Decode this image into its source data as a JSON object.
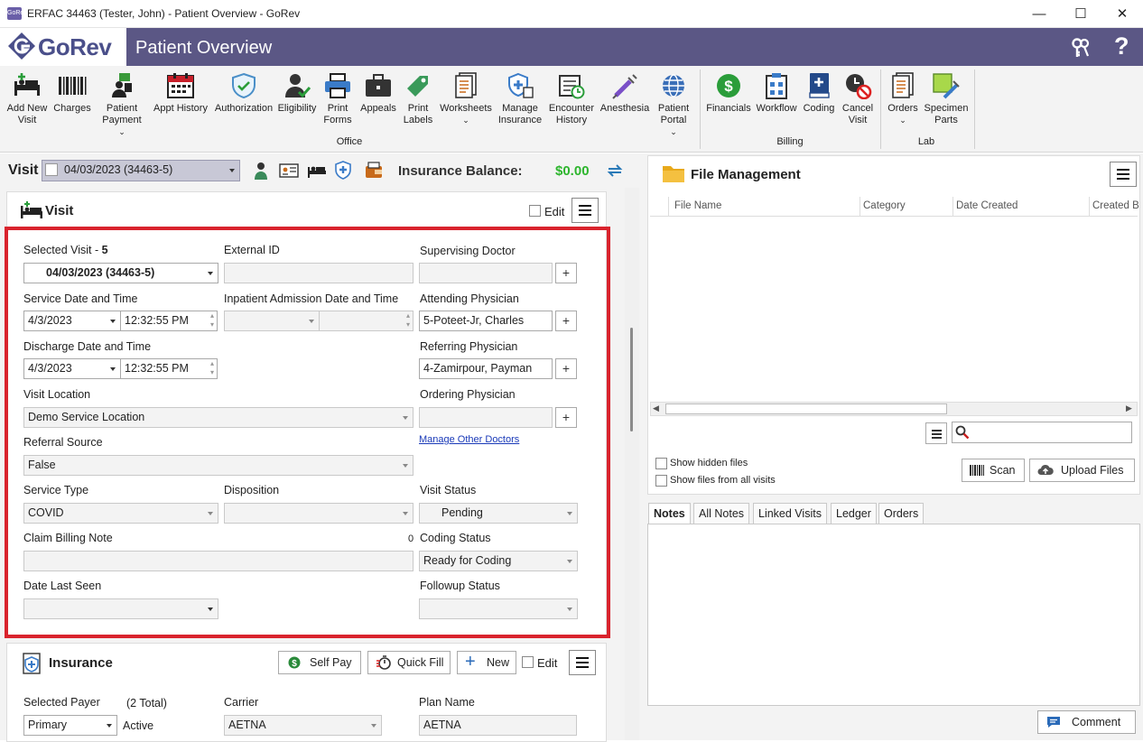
{
  "window": {
    "title": "ERFAC 34463 (Tester, John) - Patient Overview - GoRev",
    "app_icon_text": "GoRev"
  },
  "header": {
    "logo": "GoRev",
    "title": "Patient Overview"
  },
  "ribbon": {
    "office": [
      {
        "label": "Add New Visit",
        "icon": "add-visit-icon"
      },
      {
        "label": "Charges",
        "icon": "barcode-icon"
      },
      {
        "label": "Patient Payment",
        "icon": "payment-icon"
      },
      {
        "label": "Appt History",
        "icon": "calendar-icon"
      },
      {
        "label": "Authorization",
        "icon": "shield-check-icon"
      },
      {
        "label": "Eligibility",
        "icon": "person-check-icon"
      },
      {
        "label": "Print Forms",
        "icon": "printer-icon"
      },
      {
        "label": "Appeals",
        "icon": "briefcase-icon"
      },
      {
        "label": "Print Labels",
        "icon": "tag-icon"
      },
      {
        "label": "Worksheets",
        "icon": "worksheets-icon"
      },
      {
        "label": "Manage Insurance",
        "icon": "insurance-icon"
      },
      {
        "label": "Encounter History",
        "icon": "encounter-history-icon"
      },
      {
        "label": "Anesthesia",
        "icon": "syringe-icon"
      },
      {
        "label": "Patient Portal",
        "icon": "globe-icon"
      }
    ],
    "billing": [
      {
        "label": "Financials",
        "icon": "dollar-icon"
      },
      {
        "label": "Workflow",
        "icon": "workflow-icon"
      },
      {
        "label": "Coding",
        "icon": "coding-book-icon"
      },
      {
        "label": "Cancel Visit",
        "icon": "cancel-visit-icon"
      }
    ],
    "lab": [
      {
        "label": "Orders",
        "icon": "orders-icon"
      },
      {
        "label": "Specimen Parts",
        "icon": "specimen-icon"
      }
    ],
    "groups": {
      "office": "Office",
      "billing": "Billing",
      "lab": "Lab"
    }
  },
  "visitbar": {
    "label": "Visit",
    "selected": "04/03/2023 (34463-5)",
    "insurance_balance_label": "Insurance Balance:",
    "insurance_balance": "$0.00"
  },
  "visit_panel": {
    "title": "Visit",
    "edit_label": "Edit",
    "selected_visit_label": "Selected Visit -",
    "selected_visit_num": "5",
    "selected_visit_value": "04/03/2023 (34463-5)",
    "external_id_label": "External ID",
    "external_id": "",
    "supervising_label": "Supervising Doctor",
    "supervising": "",
    "service_dt_label": "Service Date and Time",
    "service_date": "4/3/2023",
    "service_time": "12:32:55 PM",
    "inpatient_label": "Inpatient Admission Date and Time",
    "attending_label": "Attending Physician",
    "attending": "5-Poteet-Jr, Charles",
    "discharge_label": "Discharge Date and Time",
    "discharge_date": "4/3/2023",
    "discharge_time": "12:32:55 PM",
    "referring_label": "Referring Physician",
    "referring": "4-Zamirpour, Payman",
    "location_label": "Visit Location",
    "location": "Demo Service Location",
    "ordering_label": "Ordering Physician",
    "ordering": "",
    "referral_label": "Referral Source",
    "referral": "False",
    "manage_doctors": "Manage Other Doctors",
    "service_type_label": "Service Type",
    "service_type": "COVID",
    "disposition_label": "Disposition",
    "disposition": "",
    "visit_status_label": "Visit Status",
    "visit_status": "Pending",
    "claim_note_label": "Claim Billing Note",
    "claim_note_count": "0",
    "claim_note": "",
    "coding_status_label": "Coding Status",
    "coding_status": "Ready for Coding",
    "last_seen_label": "Date Last Seen",
    "last_seen": "",
    "followup_label": "Followup Status",
    "followup": ""
  },
  "insurance_panel": {
    "title": "Insurance",
    "self_pay": "Self Pay",
    "quick_fill": "Quick Fill",
    "new": "New",
    "edit_label": "Edit",
    "payer_label": "Selected Payer",
    "total": "(2 Total)",
    "payer": "Primary",
    "active": "Active",
    "carrier_label": "Carrier",
    "carrier": "AETNA",
    "plan_label": "Plan Name",
    "plan": "AETNA"
  },
  "files": {
    "title": "File Management",
    "columns": [
      "File Name",
      "Category",
      "Date Created",
      "Created B"
    ],
    "show_hidden": "Show hidden files",
    "show_all": "Show files from all visits",
    "scan": "Scan",
    "upload": "Upload Files",
    "search_placeholder": ""
  },
  "notes": {
    "tabs": [
      "Notes",
      "All Notes",
      "Linked Visits",
      "Ledger",
      "Orders"
    ],
    "comment": "Comment"
  },
  "colors": {
    "header": "#5b5785",
    "highlight": "#d9232d",
    "balance": "#2db52d"
  }
}
